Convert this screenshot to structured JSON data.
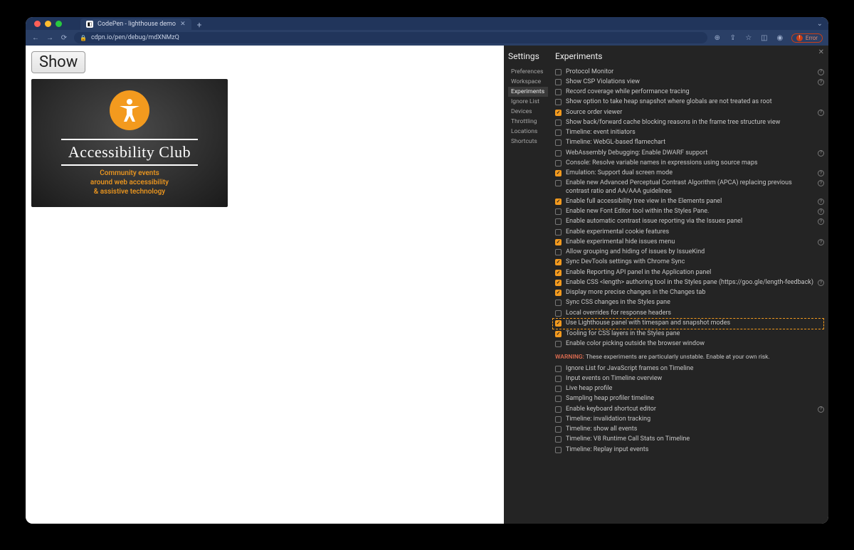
{
  "browser": {
    "tab_title": "CodePen - lighthouse demo",
    "url": "cdpn.io/pen/debug/mdXNMzQ",
    "error_label": "Error"
  },
  "page": {
    "show_button": "Show",
    "card_title": "Accessibility Club",
    "card_sub1": "Community events",
    "card_sub2": "around web accessibility",
    "card_sub3": "& assistive technology"
  },
  "devtools": {
    "settings_title": "Settings",
    "nav": [
      "Preferences",
      "Workspace",
      "Experiments",
      "Ignore List",
      "Devices",
      "Throttling",
      "Locations",
      "Shortcuts"
    ],
    "nav_active": "Experiments",
    "experiments_title": "Experiments",
    "experiments": [
      {
        "label": "Protocol Monitor",
        "checked": false,
        "info": true
      },
      {
        "label": "Show CSP Violations view",
        "checked": false,
        "info": true
      },
      {
        "label": "Record coverage while performance tracing",
        "checked": false
      },
      {
        "label": "Show option to take heap snapshot where globals are not treated as root",
        "checked": false
      },
      {
        "label": "Source order viewer",
        "checked": true,
        "info": true
      },
      {
        "label": "Show back/forward cache blocking reasons in the frame tree structure view",
        "checked": false
      },
      {
        "label": "Timeline: event initiators",
        "checked": false
      },
      {
        "label": "Timeline: WebGL-based flamechart",
        "checked": false
      },
      {
        "label": "WebAssembly Debugging: Enable DWARF support",
        "checked": false,
        "info": true
      },
      {
        "label": "Console: Resolve variable names in expressions using source maps",
        "checked": false
      },
      {
        "label": "Emulation: Support dual screen mode",
        "checked": true,
        "info": true
      },
      {
        "label": "Enable new Advanced Perceptual Contrast Algorithm (APCA) replacing previous contrast ratio and AA/AAA guidelines",
        "checked": false,
        "info": true,
        "info_right": true
      },
      {
        "label": "Enable full accessibility tree view in the Elements panel",
        "checked": true,
        "info": true
      },
      {
        "label": "Enable new Font Editor tool within the Styles Pane.",
        "checked": false,
        "info": true
      },
      {
        "label": "Enable automatic contrast issue reporting via the Issues panel",
        "checked": false,
        "info": true
      },
      {
        "label": "Enable experimental cookie features",
        "checked": false
      },
      {
        "label": "Enable experimental hide issues menu",
        "checked": true,
        "info": true
      },
      {
        "label": "Allow grouping and hiding of issues by IssueKind",
        "checked": false
      },
      {
        "label": "Sync DevTools settings with Chrome Sync",
        "checked": true
      },
      {
        "label": "Enable Reporting API panel in the Application panel",
        "checked": true
      },
      {
        "label": "Enable CSS <length> authoring tool in the Styles pane (https://goo.gle/length-feedback)",
        "checked": true,
        "info": true
      },
      {
        "label": "Display more precise changes in the Changes tab",
        "checked": true
      },
      {
        "label": "Sync CSS changes in the Styles pane",
        "checked": false
      },
      {
        "label": "Local overrides for response headers",
        "checked": false
      },
      {
        "label": "Use Lighthouse panel with timespan and snapshot modes",
        "checked": true,
        "highlight": true
      },
      {
        "label": "Tooling for CSS layers in the Styles pane",
        "checked": true
      },
      {
        "label": "Enable color picking outside the browser window",
        "checked": false
      }
    ],
    "warning_label": "WARNING:",
    "warning_text": " These experiments are particularly unstable. Enable at your own risk.",
    "unstable": [
      {
        "label": "Ignore List for JavaScript frames on Timeline",
        "checked": false
      },
      {
        "label": "Input events on Timeline overview",
        "checked": false
      },
      {
        "label": "Live heap profile",
        "checked": false
      },
      {
        "label": "Sampling heap profiler timeline",
        "checked": false
      },
      {
        "label": "Enable keyboard shortcut editor",
        "checked": false,
        "info": true
      },
      {
        "label": "Timeline: invalidation tracking",
        "checked": false
      },
      {
        "label": "Timeline: show all events",
        "checked": false
      },
      {
        "label": "Timeline: V8 Runtime Call Stats on Timeline",
        "checked": false
      },
      {
        "label": "Timeline: Replay input events",
        "checked": false
      }
    ]
  }
}
